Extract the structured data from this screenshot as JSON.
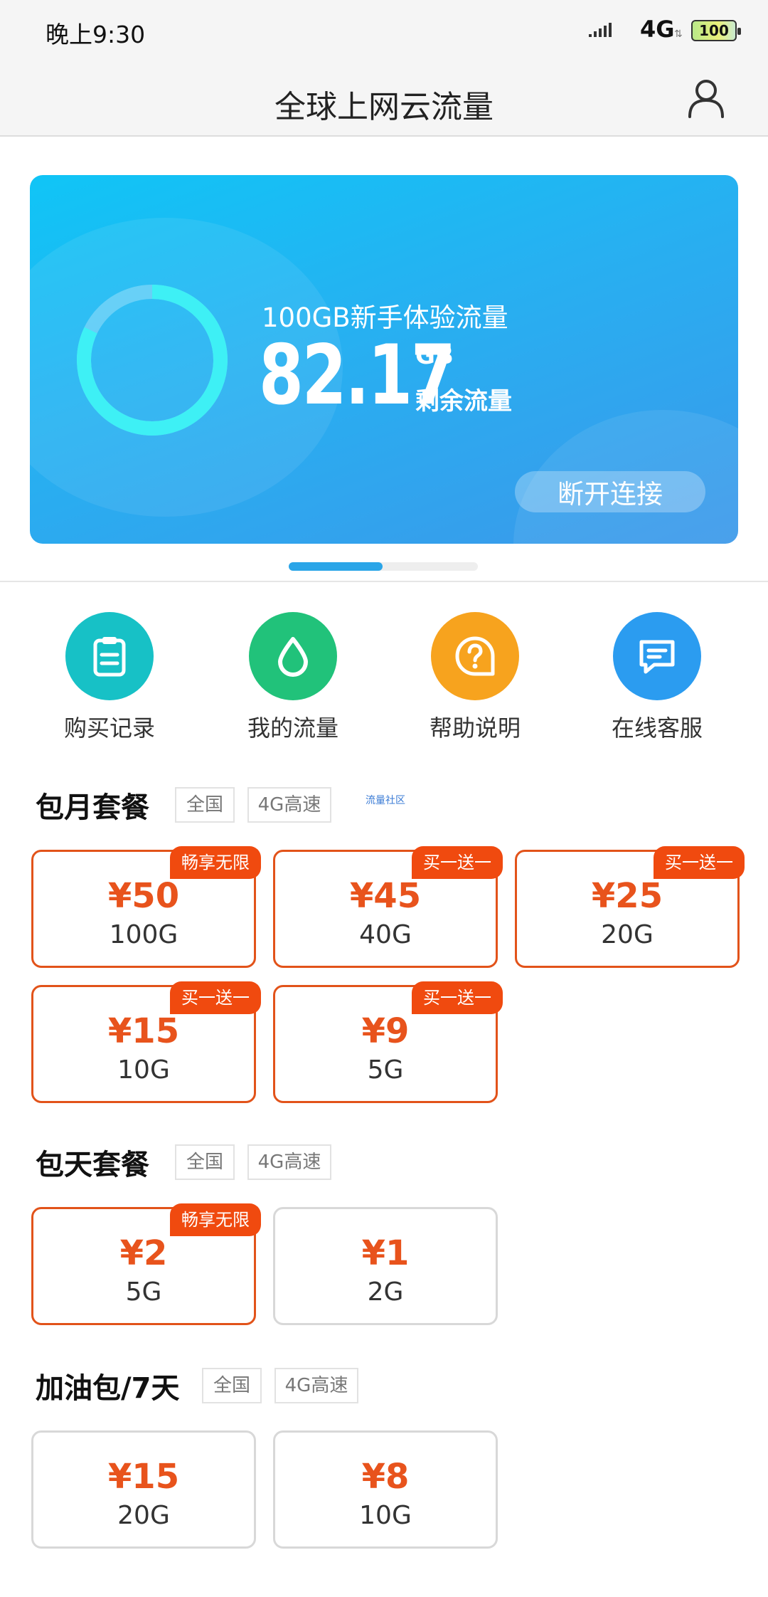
{
  "status_bar": {
    "time": "晚上9:30",
    "network": "4G",
    "battery": "100"
  },
  "header": {
    "title": "全球上网云流量"
  },
  "data_card": {
    "plan_name": "100GB新手体验流量",
    "remaining_value": "82.17",
    "remaining_unit": "GB",
    "remaining_label": "剩余流量",
    "ring_remaining_fraction": 0.8217,
    "disconnect_label": "断开连接"
  },
  "quick_actions": [
    {
      "label": "购买记录",
      "icon": "clipboard-icon",
      "color": "#17c1c6"
    },
    {
      "label": "我的流量",
      "icon": "drop-icon",
      "color": "#21c27a"
    },
    {
      "label": "帮助说明",
      "icon": "help-icon",
      "color": "#f7a31e"
    },
    {
      "label": "在线客服",
      "icon": "chat-icon",
      "color": "#2b9cf0"
    }
  ],
  "monthly": {
    "title": "包月套餐",
    "tags": [
      "全国",
      "4G高速"
    ],
    "extra_link": "流量社区",
    "packages": [
      {
        "price": "¥50",
        "size": "100G",
        "badge": "畅享无限"
      },
      {
        "price": "¥45",
        "size": "40G",
        "badge": "买一送一"
      },
      {
        "price": "¥25",
        "size": "20G",
        "badge": "买一送一"
      },
      {
        "price": "¥15",
        "size": "10G",
        "badge": "买一送一"
      },
      {
        "price": "¥9",
        "size": "5G",
        "badge": "买一送一"
      }
    ]
  },
  "daily": {
    "title": "包天套餐",
    "tags": [
      "全国",
      "4G高速"
    ],
    "packages": [
      {
        "price": "¥2",
        "size": "5G",
        "badge": "畅享无限"
      },
      {
        "price": "¥1",
        "size": "2G"
      }
    ]
  },
  "addon": {
    "title": "加油包/7天",
    "tags": [
      "全国",
      "4G高速"
    ],
    "packages": [
      {
        "price": "¥15",
        "size": "20G"
      },
      {
        "price": "¥8",
        "size": "10G"
      }
    ]
  },
  "colors": {
    "accent_orange": "#e8531c",
    "badge_orange": "#f04a0f",
    "card_blue": "#27b0f1",
    "ring_cyan": "#3ef0f5"
  }
}
